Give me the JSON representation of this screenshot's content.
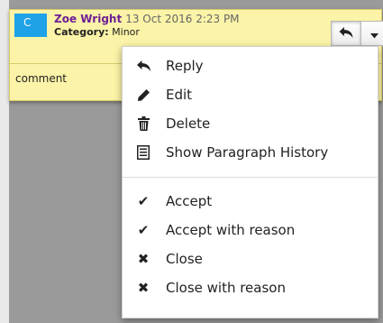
{
  "comment": {
    "badge": "C",
    "author": "Zoe Wright",
    "timestamp": "13 Oct 2016 2:23 PM",
    "category_label": "Category:",
    "category_value": "Minor",
    "text": "comment",
    "buttons": {
      "reply_icon": "reply-icon",
      "menu_icon": "chevron-down-icon"
    }
  },
  "menu": {
    "groups": [
      [
        {
          "label": "Reply",
          "icon": "reply-icon"
        },
        {
          "label": "Edit",
          "icon": "pencil-icon"
        },
        {
          "label": "Delete",
          "icon": "trash-icon"
        },
        {
          "label": "Show Paragraph History",
          "icon": "document-icon"
        }
      ],
      [
        {
          "label": "Accept",
          "icon": "check-icon"
        },
        {
          "label": "Accept with reason",
          "icon": "check-icon"
        },
        {
          "label": "Close",
          "icon": "x-icon"
        },
        {
          "label": "Close with reason",
          "icon": "x-icon"
        }
      ]
    ]
  },
  "colors": {
    "badge": "#1ea2e8",
    "author": "#6d1f96",
    "card_background": "#fbf3a7",
    "overlay": "#9a9a9a"
  }
}
